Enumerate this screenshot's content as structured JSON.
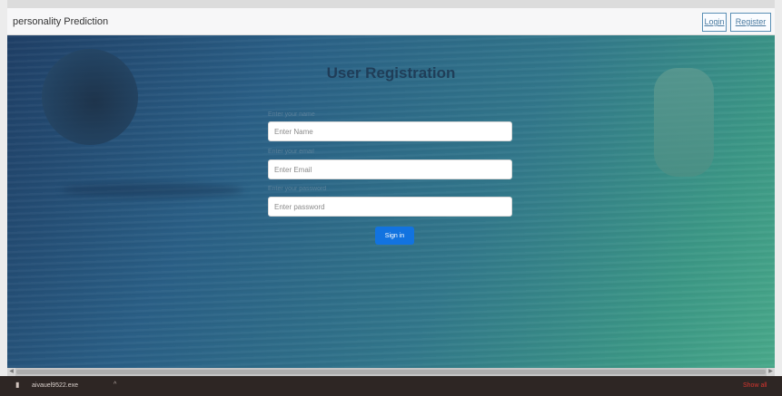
{
  "navbar": {
    "brand": "personality Prediction",
    "login_label": "Login",
    "register_label": "Register"
  },
  "form": {
    "title": "User Registration",
    "name_label": "Enter your name",
    "name_placeholder": "Enter Name",
    "email_label": "Enter your email",
    "email_placeholder": "Enter Email",
    "password_label": "Enter your password",
    "password_placeholder": "Enter password",
    "submit_label": "Sign in"
  },
  "download_bar": {
    "file_name": "aivauel9522.exe",
    "caret": "^",
    "show_all_label": "Show all"
  },
  "colors": {
    "primary_button": "#1273e0",
    "hero_start": "#1f3f66",
    "hero_end": "#49a98a"
  }
}
